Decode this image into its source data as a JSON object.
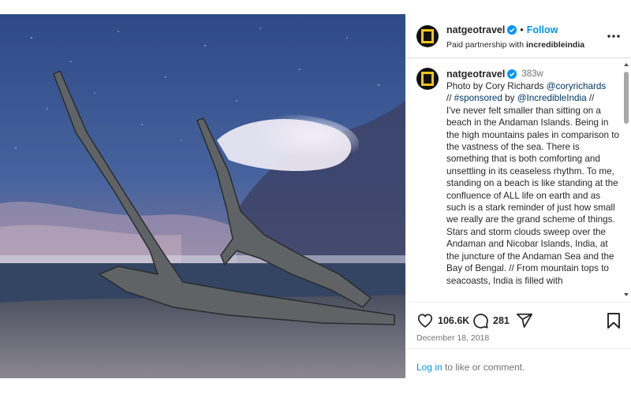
{
  "header": {
    "username": "natgeotravel",
    "separator": "•",
    "follow_label": "Follow",
    "partnership_prefix": "Paid partnership with",
    "partner_name": "incredibleindia"
  },
  "caption": {
    "username": "natgeotravel",
    "time_ago": "383w",
    "text_1": "Photo by Cory Richards ",
    "mention_1": "@coryrichards",
    "text_2": "\n// ",
    "hashtag": "#sponsored",
    "text_3": " by ",
    "mention_2": "@IncredibleIndia",
    "text_4": " //\nI've never felt smaller than sitting on a beach in the Andaman Islands. Being in the high mountains pales in comparison to the vastness of the sea. There is something that is both comforting and unsettling in its ceaseless rhythm.  To me, standing on a beach is like standing at the confluence of ALL life on earth and as such is a stark reminder of just how small we really are the grand scheme of things. Stars and storm clouds sweep over the Andaman and Nicobar Islands, India, at the juncture of the Andaman Sea and the Bay of Bengal. // From mountain tops to seacoasts, India is filled with"
  },
  "actions": {
    "likes": "106.6K",
    "comments": "281"
  },
  "date": "December 18, 2018",
  "login": {
    "link_label": "Log in",
    "rest_text": " to like or comment."
  },
  "colors": {
    "accent_link": "#0095f6",
    "mention_link": "#00376b",
    "verified": "#0095f6",
    "secondary_text": "#737373"
  },
  "icons": {
    "verified": "verified-badge-icon",
    "more": "more-options-icon",
    "like": "heart-icon",
    "comment": "comment-bubble-icon",
    "share": "paper-plane-icon",
    "save": "bookmark-icon"
  }
}
